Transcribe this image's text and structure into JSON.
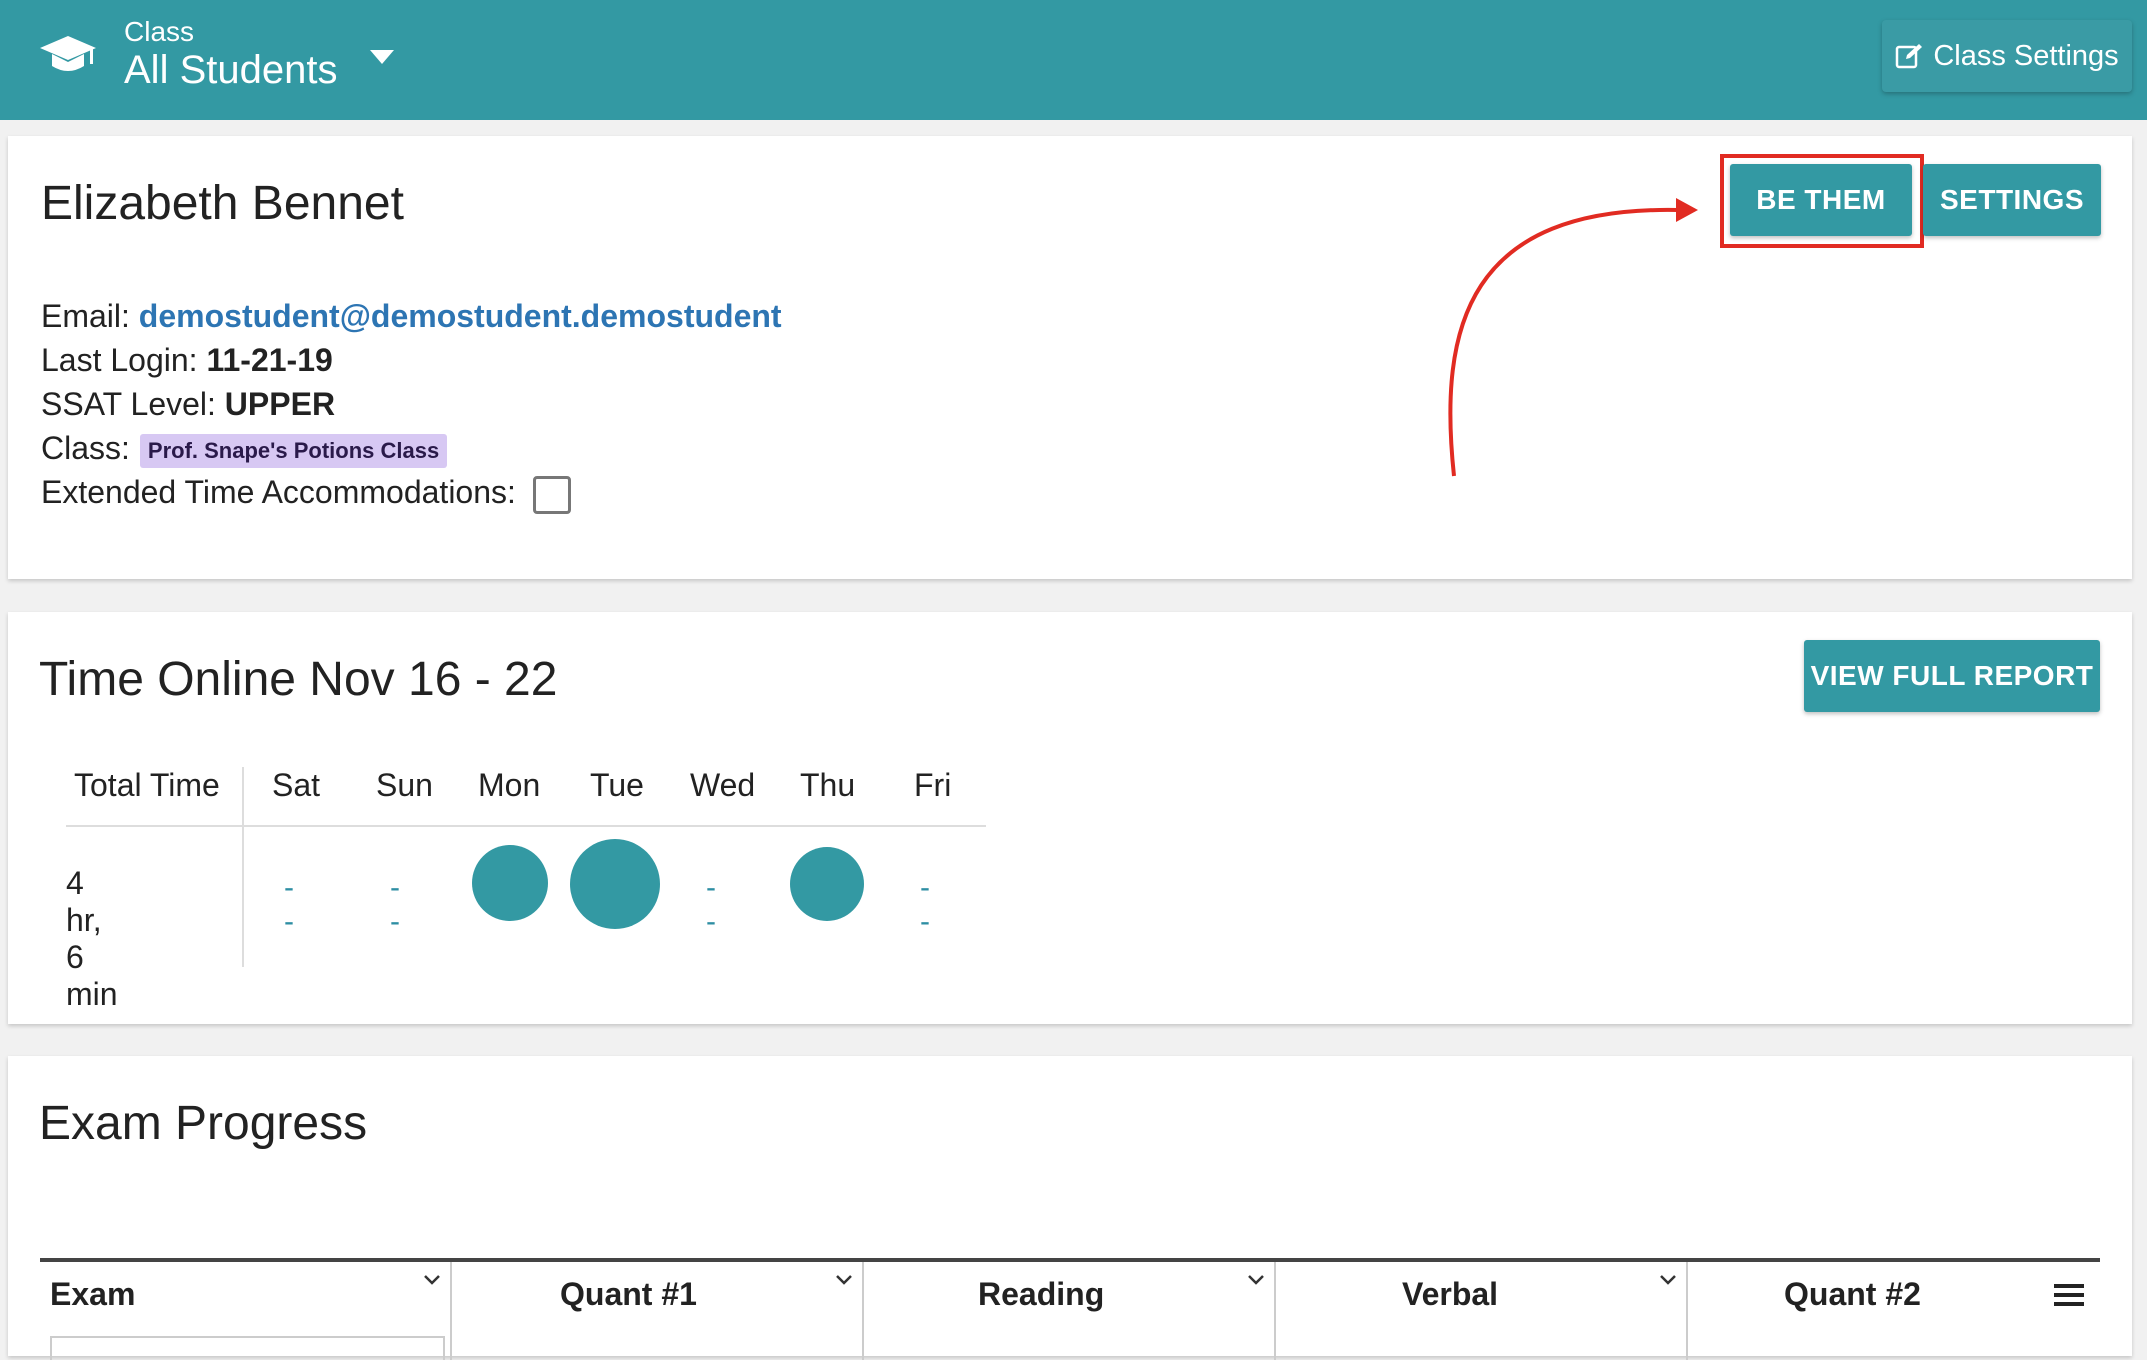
{
  "topbar": {
    "class_label": "Class",
    "class_value": "All Students",
    "class_settings_label": "Class Settings",
    "icons": {
      "cap": "graduation-cap-icon",
      "caret": "caret-down-icon",
      "edit": "edit-icon"
    },
    "color": "#3399a3"
  },
  "student": {
    "name": "Elizabeth Bennet",
    "email_label": "Email:",
    "email": "demostudent@demostudent.demostudent",
    "last_login_label": "Last Login:",
    "last_login": "11-21-19",
    "ssat_label": "SSAT Level:",
    "ssat": "UPPER",
    "class_label": "Class:",
    "class_name": "Prof. Snape's Potions Class",
    "extended_label": "Extended Time Accommodations:",
    "extended_checked": false,
    "be_them_label": "BE THEM",
    "settings_label": "SETTINGS",
    "highlight_color": "#e12b22"
  },
  "time_online": {
    "title": "Time Online Nov 16 - 22",
    "report_label": "VIEW FULL REPORT",
    "total_header": "Total Time",
    "total_value": "4 hr, 6 min",
    "days": [
      {
        "name": "Sat",
        "value": "--"
      },
      {
        "name": "Sun",
        "value": "--"
      },
      {
        "name": "Mon",
        "value": ""
      },
      {
        "name": "Tue",
        "value": ""
      },
      {
        "name": "Wed",
        "value": "--"
      },
      {
        "name": "Thu",
        "value": ""
      },
      {
        "name": "Fri",
        "value": "--"
      }
    ]
  },
  "exam_progress": {
    "title": "Exam Progress",
    "columns": [
      "Exam",
      "Quant #1",
      "Reading",
      "Verbal",
      "Quant #2"
    ],
    "icons": {
      "column_menu": "chevron-down-icon",
      "table_menu": "menu-icon"
    }
  }
}
